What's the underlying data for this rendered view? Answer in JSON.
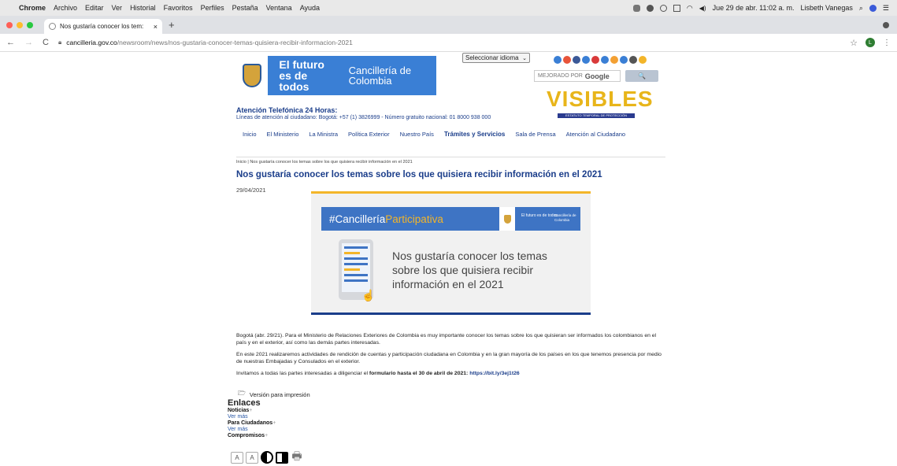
{
  "menubar": {
    "app": "Chrome",
    "items": [
      "Archivo",
      "Editar",
      "Ver",
      "Historial",
      "Favoritos",
      "Perfiles",
      "Pestaña",
      "Ventana",
      "Ayuda"
    ],
    "datetime": "Jue 29 de abr. 11:02 a. m.",
    "user": "Lisbeth Vanegas"
  },
  "tab": {
    "title": "Nos gustaría conocer los tem:",
    "close": "×",
    "new_tab": "+"
  },
  "toolbar": {
    "url_host": "cancilleria.gov.co",
    "url_path": "/newsroom/news/nos-gustaria-conocer-temas-quisiera-recibir-informacion-2021",
    "profile_initial": "L"
  },
  "header": {
    "futuro": "El futuro es de todos",
    "cancilleria": "Cancillería de Colombia",
    "language_select": "Seleccionar idioma",
    "search_label": "MEJORADO POR",
    "search_brand": "Google",
    "search_button": "🔍",
    "visibles_word": "VISIBLES",
    "visibles_strip": "ESTATUTO TEMPORAL DE PROTECCIÓN",
    "atencion": "Atención Telefónica 24 Horas:",
    "lineas": "Líneas de atención al ciudadano: Bogotá: +57 (1) 3826999 - Número gratuito nacional: 01 8000 938 000",
    "social_colors": [
      "#3a7fd5",
      "#e8543a",
      "#3b5998",
      "#3a7fd5",
      "#d93a3a",
      "#3a7fd5",
      "#f3a033",
      "#3a7fd5",
      "#555555",
      "#f3b529"
    ]
  },
  "nav": {
    "items": [
      "Inicio",
      "El Ministerio",
      "La Ministra",
      "Política Exterior",
      "Nuestro País",
      "Trámites y Servicios",
      "Sala de Prensa",
      "Atención al Ciudadano"
    ]
  },
  "article": {
    "breadcrumb": "Inicio | Nos gustaría conocer los temas sobre los que quisiera recibir información en el 2021",
    "title": "Nos gustaría conocer los temas sobre los que quisiera recibir información en el 2021",
    "date": "29/04/2021",
    "image_hashtag_a": "#Cancillería",
    "image_hashtag_b": "Participativa",
    "image_futuro": "El futuro es de todos",
    "image_cancilleria": "Cancillería de Colombia",
    "image_message": "Nos gustaría conocer los temas sobre los que quisiera recibir información en el 2021",
    "p1": "Bogotá (abr. 29/21). Para el Ministerio de Relaciones Exteriores de Colombia es muy importante conocer los temas sobre los que quisieran ser informados los colombianos en el país y en el exterior, así como las demás partes interesadas.",
    "p2": "En este 2021 realizaremos actividades de rendición de cuentas y participación ciudadana en Colombia y en la gran mayoría de los países en los que tenemos presencia por medio de nuestras Embajadas y Consulados en el exterior.",
    "p3_start": "Invitamos a todas las partes interesadas a diligenciar el ",
    "p3_bold": "formulario hasta el 30 de abril de 2021:",
    "p3_link": "https://bit.ly/3ej1t26",
    "print_version": "Versión para impresión"
  },
  "enlaces": {
    "heading": "Enlaces",
    "noticias": "Noticias",
    "ver_mas_1": "Ver más",
    "ciudadanos": "Para Ciudadanos",
    "ver_mas_2": "Ver más",
    "compromisos": "Compromisos",
    "plus": "+"
  },
  "accessibility": {
    "increase": "A",
    "decrease": "A"
  }
}
